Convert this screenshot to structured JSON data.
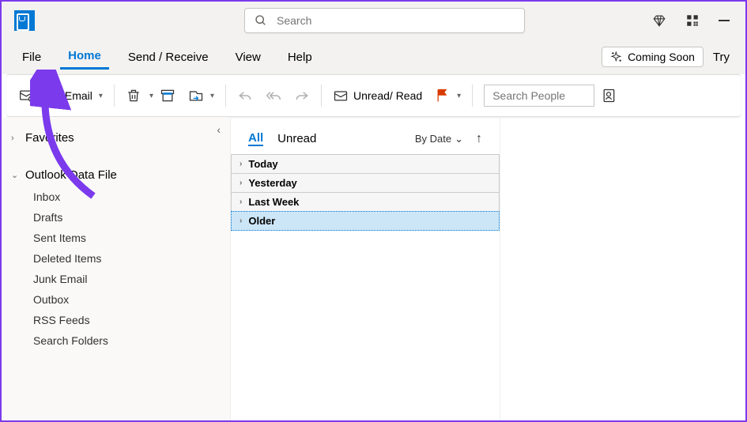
{
  "search": {
    "placeholder": "Search"
  },
  "tabs": {
    "file": "File",
    "home": "Home",
    "send_receive": "Send / Receive",
    "view": "View",
    "help": "Help",
    "coming_soon": "Coming Soon",
    "try": "Try"
  },
  "toolbar": {
    "new_email": "New Email",
    "unread_read": "Unread/ Read",
    "search_people_placeholder": "Search People"
  },
  "sidebar": {
    "favorites": "Favorites",
    "data_file": "Outlook Data File",
    "folders": [
      "Inbox",
      "Drafts",
      "Sent Items",
      "Deleted Items",
      "Junk Email",
      "Outbox",
      "RSS Feeds",
      "Search Folders"
    ]
  },
  "msglist": {
    "filter_all": "All",
    "filter_unread": "Unread",
    "by_date": "By Date",
    "groups": [
      "Today",
      "Yesterday",
      "Last Week",
      "Older"
    ]
  }
}
